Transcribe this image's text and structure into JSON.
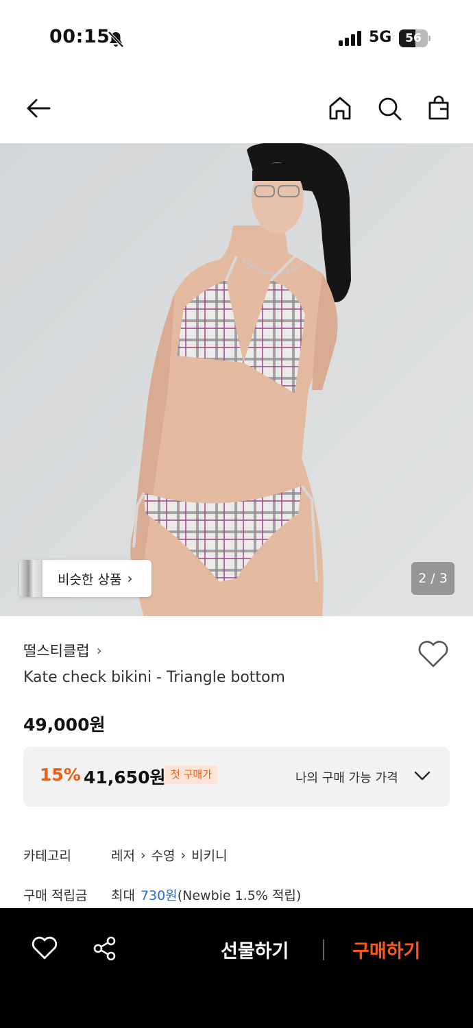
{
  "status_bar": {
    "time": "00:15",
    "network": "5G",
    "battery_level": "56",
    "icons": [
      "bell-slash-icon",
      "signal-icon",
      "battery-icon"
    ]
  },
  "nav": {
    "icons": [
      "back-arrow-icon",
      "home-icon",
      "search-icon",
      "shopping-bag-icon"
    ]
  },
  "hero": {
    "similar_products_label": "비슷한 상품",
    "page_indicator": "2 / 3"
  },
  "product": {
    "brand": "떨스티클럽",
    "name": "Kate check bikini - Triangle bottom",
    "original_price": "49,000원",
    "discount": {
      "rate": "15%",
      "price": "41,650원",
      "badge": "첫 구매가",
      "my_price_label": "나의 구매 가능 가격"
    },
    "category": {
      "label": "카테고리",
      "path": [
        "레저",
        "수영",
        "비키니"
      ]
    },
    "points": {
      "label": "구매 적립금",
      "prefix": "최대",
      "amount": "730원",
      "suffix": "(Newbie 1.5% 적립)"
    }
  },
  "bottom_bar": {
    "gift_label": "선물하기",
    "buy_label": "구매하기",
    "icons": [
      "heart-icon",
      "share-icon"
    ]
  },
  "colors": {
    "accent": "#ec5d14",
    "buy": "#ff5a14",
    "link": "#2a6fd6",
    "badge_bg": "#fde4d6"
  }
}
